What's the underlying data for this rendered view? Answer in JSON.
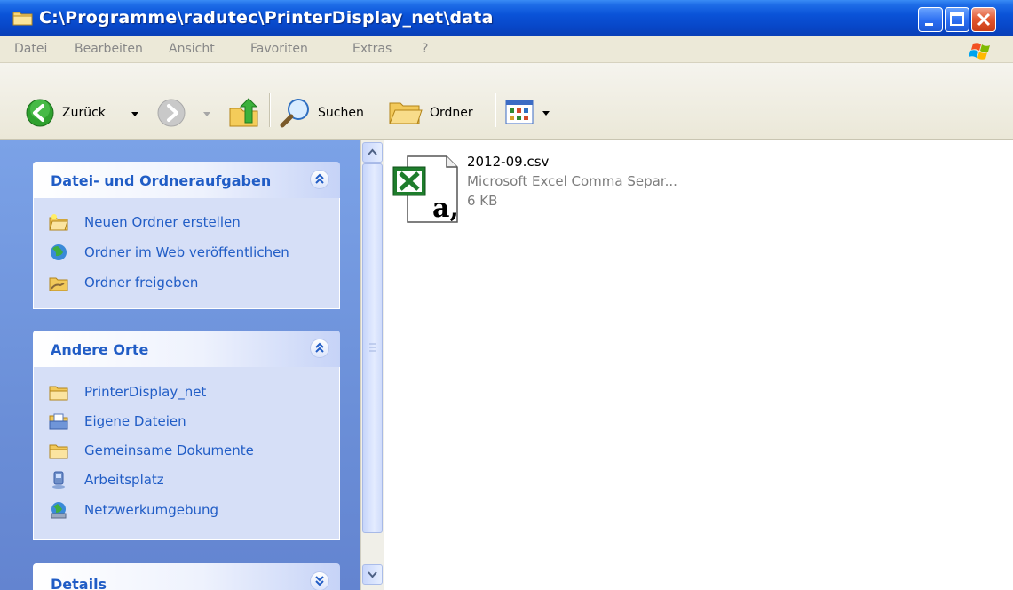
{
  "window": {
    "title": "C:\\Programme\\radutec\\PrinterDisplay_net\\data"
  },
  "menu": [
    "Datei",
    "Bearbeiten",
    "Ansicht",
    "Favoriten",
    "Extras",
    "?"
  ],
  "toolbar": {
    "back_label": "Zurück",
    "search_label": "Suchen",
    "folders_label": "Ordner"
  },
  "task_panels": {
    "file_tasks": {
      "title": "Datei- und Ordneraufgaben",
      "items": [
        "Neuen Ordner erstellen",
        "Ordner im Web veröffentlichen",
        "Ordner freigeben"
      ]
    },
    "other_places": {
      "title": "Andere Orte",
      "items": [
        "PrinterDisplay_net",
        "Eigene Dateien",
        "Gemeinsame Dokumente",
        "Arbeitsplatz",
        "Netzwerkumgebung"
      ]
    },
    "details": {
      "title": "Details"
    }
  },
  "files": [
    {
      "name": "2012-09.csv",
      "type": "Microsoft Excel Comma Separ...",
      "size": "6 KB",
      "icon": "excel-csv-icon"
    }
  ],
  "colors": {
    "titlebar": "#0a53d8",
    "taskpane": "#6b8fd8",
    "panel_title": "#215dc6",
    "panel_body": "#d6dff7"
  }
}
